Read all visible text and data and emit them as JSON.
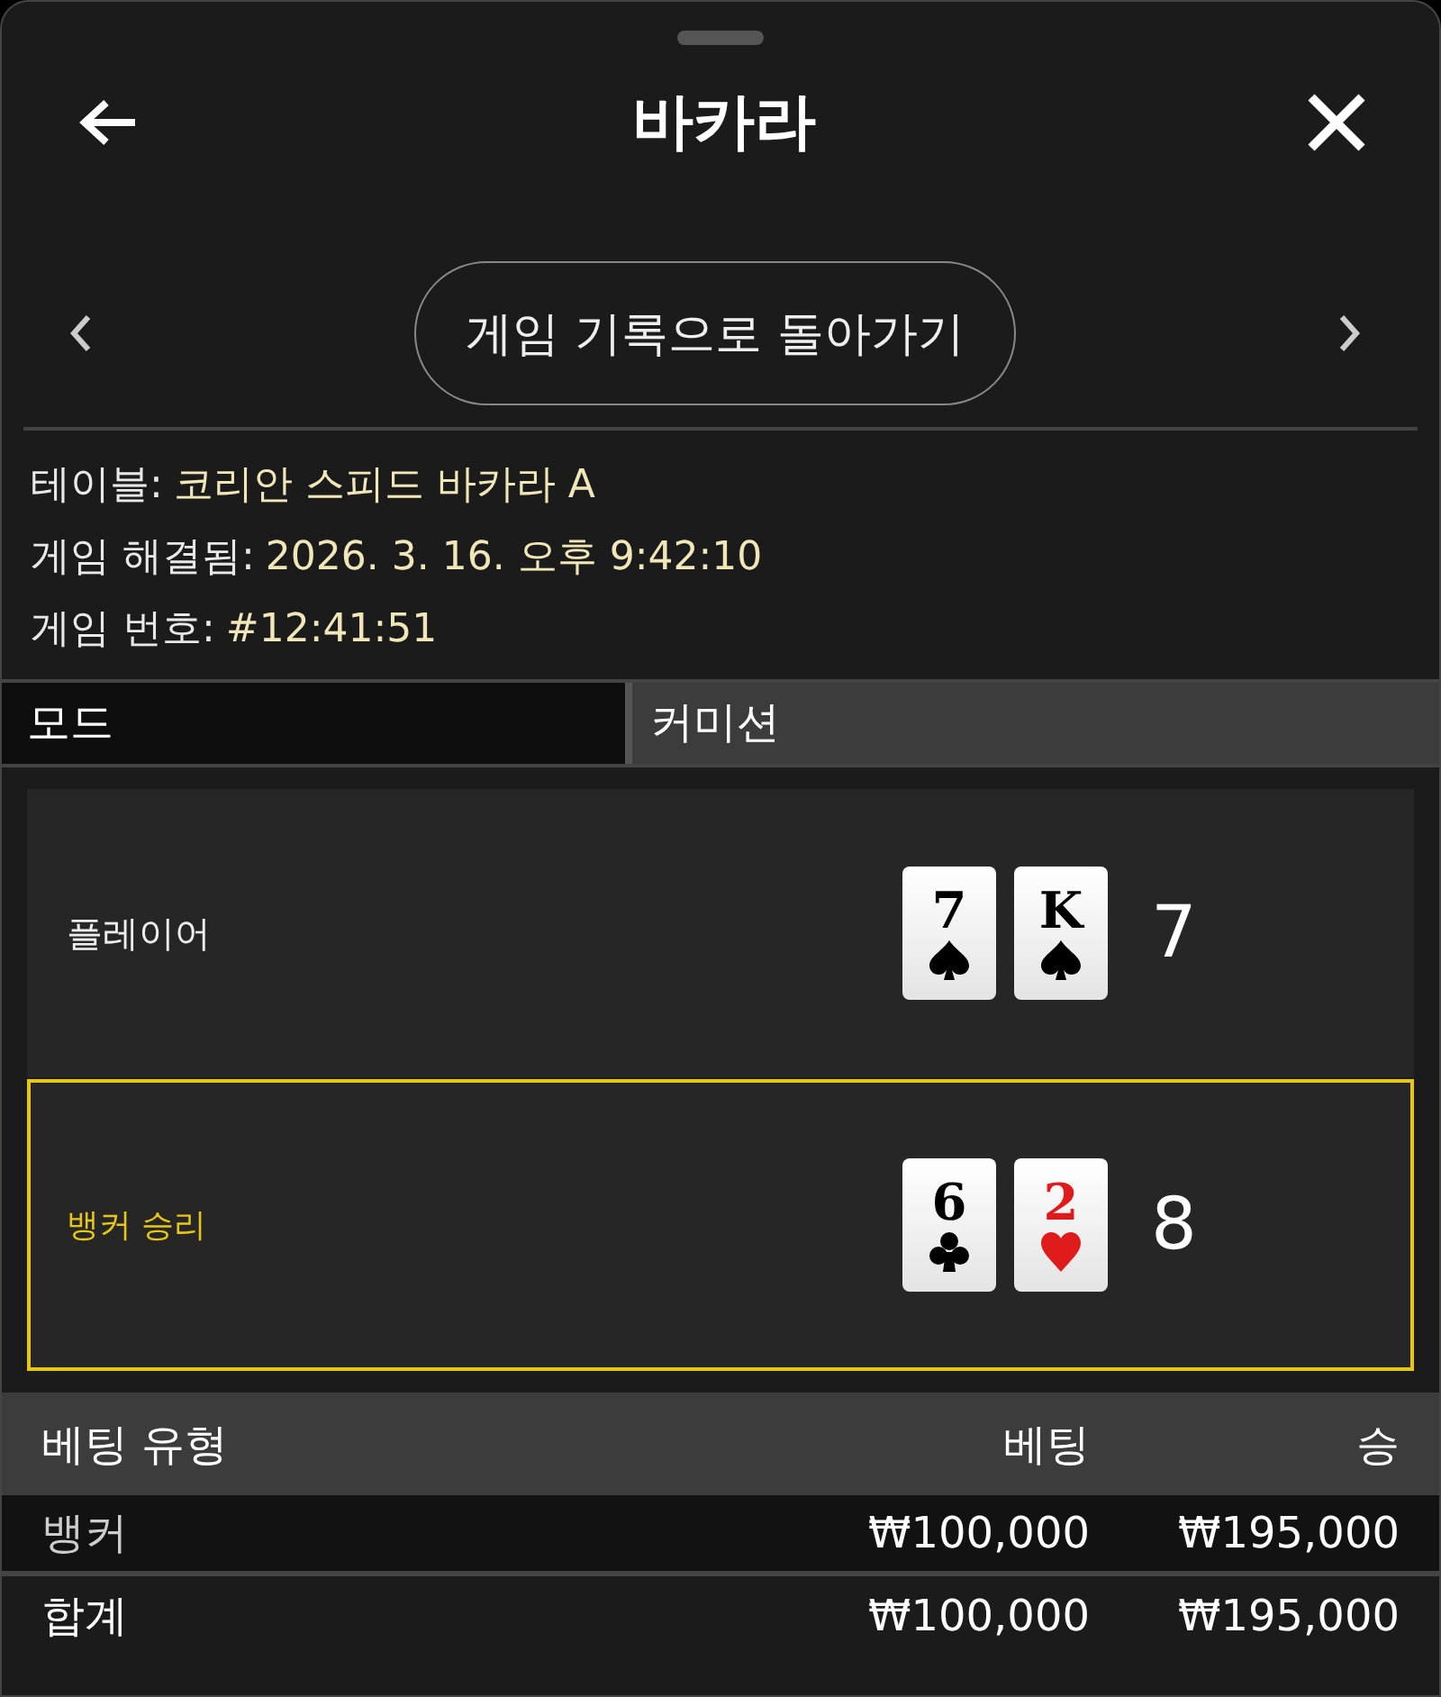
{
  "window": {
    "title": "바카라"
  },
  "nav": {
    "button": "게임 기록으로 돌아가기"
  },
  "info": [
    {
      "label": "테이블:",
      "value": "코리안 스피드 바카라 A"
    },
    {
      "label": "게임 해결됨:",
      "value": "2026. 3. 16. 오후 9:42:10"
    },
    {
      "label": "게임 번호:",
      "value": "#12:41:51"
    }
  ],
  "mode": {
    "label": "모드",
    "value": "커미션"
  },
  "hands": [
    {
      "label": "플레이어",
      "winner": false,
      "score": "7",
      "cards": [
        {
          "rank": "7",
          "kind": "spades"
        },
        {
          "rank": "K",
          "kind": "spades"
        }
      ]
    },
    {
      "label": "뱅커 승리",
      "winner": true,
      "score": "8",
      "cards": [
        {
          "rank": "6",
          "kind": "clubs"
        },
        {
          "rank": "2",
          "kind": "hearts"
        }
      ]
    }
  ],
  "bets": {
    "columns": [
      "베팅 유형",
      "베팅",
      "승"
    ],
    "rows": [
      {
        "kind": "bet",
        "cells": [
          "뱅커",
          "₩100,000",
          "₩195,000"
        ]
      },
      {
        "kind": "total",
        "cells": [
          "합계",
          "₩100,000",
          "₩195,000"
        ]
      }
    ]
  }
}
